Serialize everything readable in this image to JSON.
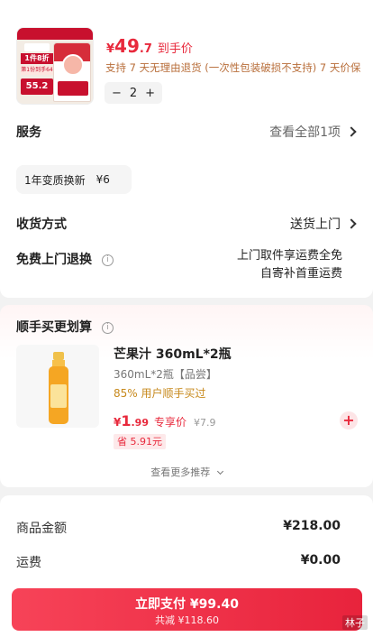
{
  "product": {
    "image_name": "rice-bag-product-image",
    "image_badge": "1件8折",
    "image_badge2": "第1份到手64",
    "image_price": "55.2",
    "currency": "¥",
    "price_int": "49",
    "price_dec": ".7",
    "price_label": "到手价",
    "return_note": "支持 7 天无理由退货 (一次性包装破损不支持)  7 天价保",
    "quantity": "2",
    "minus": "−",
    "plus": "+"
  },
  "service": {
    "label": "服务",
    "view_all": "查看全部1项",
    "chip_name": "1年变质换新",
    "chip_price": "¥6"
  },
  "delivery": {
    "label": "收货方式",
    "value": "送货上门"
  },
  "return_pickup": {
    "label": "免费上门退换",
    "info": "i",
    "line1": "上门取件享运费全免",
    "line2": "自寄补首重运费"
  },
  "addon": {
    "title": "顺手买更划算",
    "info": "i",
    "name": "芒果汁 360mL*2瓶",
    "spec": "360mL*2瓶【品尝】",
    "pct": "85% 用户顺手买过",
    "currency": "¥",
    "price_int": "1",
    "price_dec": ".99",
    "price_label": "专享价",
    "orig_price": "¥7.9",
    "save": "省 5.91元",
    "add": "+",
    "more": "查看更多推荐"
  },
  "summary": {
    "goods_label": "商品金额",
    "goods_value": "¥218.00",
    "ship_label": "运费",
    "ship_value": "¥0.00"
  },
  "pay": {
    "main": "立即支付 ¥99.40",
    "sub": "共减 ¥118.60"
  },
  "watermark": "林子",
  "colors": {
    "accent": "#e8293c",
    "warning_text": "#b86e3a",
    "pct_text": "#c7891c"
  }
}
